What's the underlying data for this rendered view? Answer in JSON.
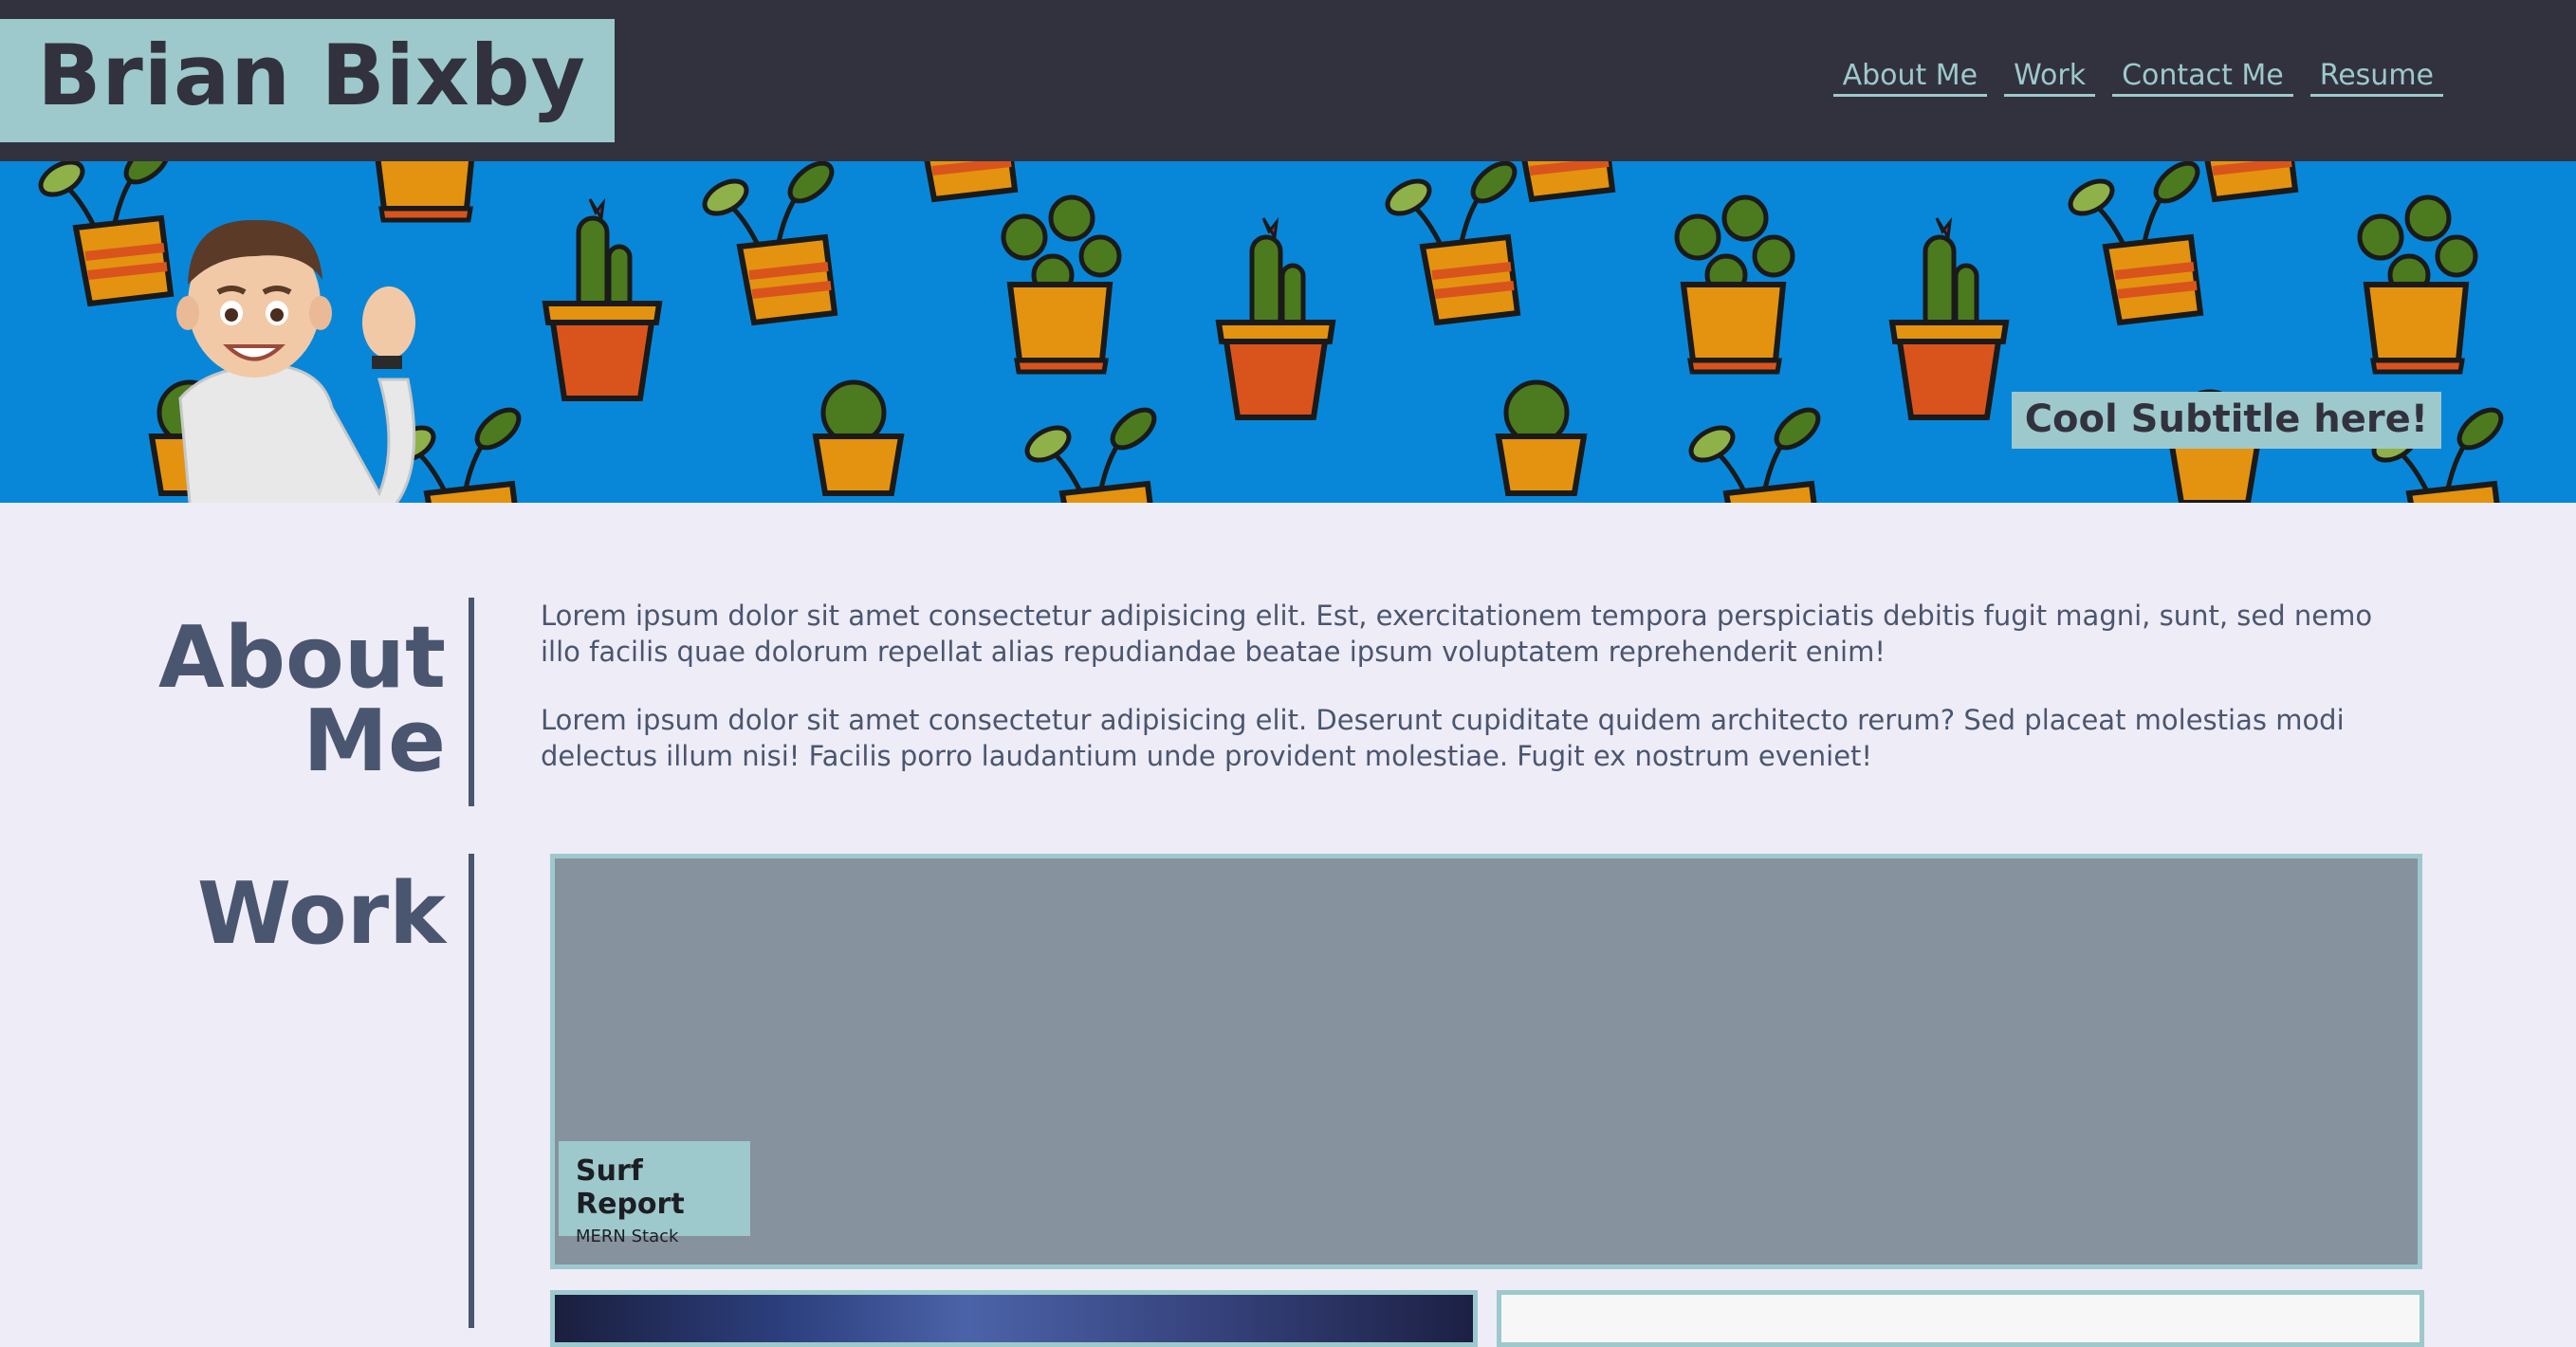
{
  "header": {
    "brand": "Brian Bixby",
    "nav": [
      "About Me",
      "Work",
      "Contact Me",
      "Resume"
    ]
  },
  "hero": {
    "subtitle": "Cool Subtitle here!"
  },
  "about": {
    "heading_line1": "About",
    "heading_line2": "Me",
    "paragraphs": [
      "Lorem ipsum dolor sit amet consectetur adipisicing elit. Est, exercitationem tempora perspiciatis debitis fugit magni, sunt, sed nemo illo facilis quae dolorum repellat alias repudiandae beatae ipsum voluptatem reprehenderit enim!",
      "Lorem ipsum dolor sit amet consectetur adipisicing elit. Deserunt cupiditate quidem architecto rerum? Sed placeat molestias modi delectus illum nisi! Facilis porro laudantium unde provident molestiae. Fugit ex nostrum eveniet!"
    ]
  },
  "work": {
    "heading": "Work",
    "projects": [
      {
        "title": "Surf Report",
        "tech": "MERN Stack"
      }
    ]
  },
  "colors": {
    "header_bg": "#32323e",
    "accent": "#9dc9cc",
    "hero_bg": "#0887d9",
    "page_bg": "#eeecf7",
    "heading_text": "#4a566f",
    "card_bg": "#86929e"
  },
  "icons": [
    "avatar-memoji",
    "plant-pot-pattern"
  ]
}
